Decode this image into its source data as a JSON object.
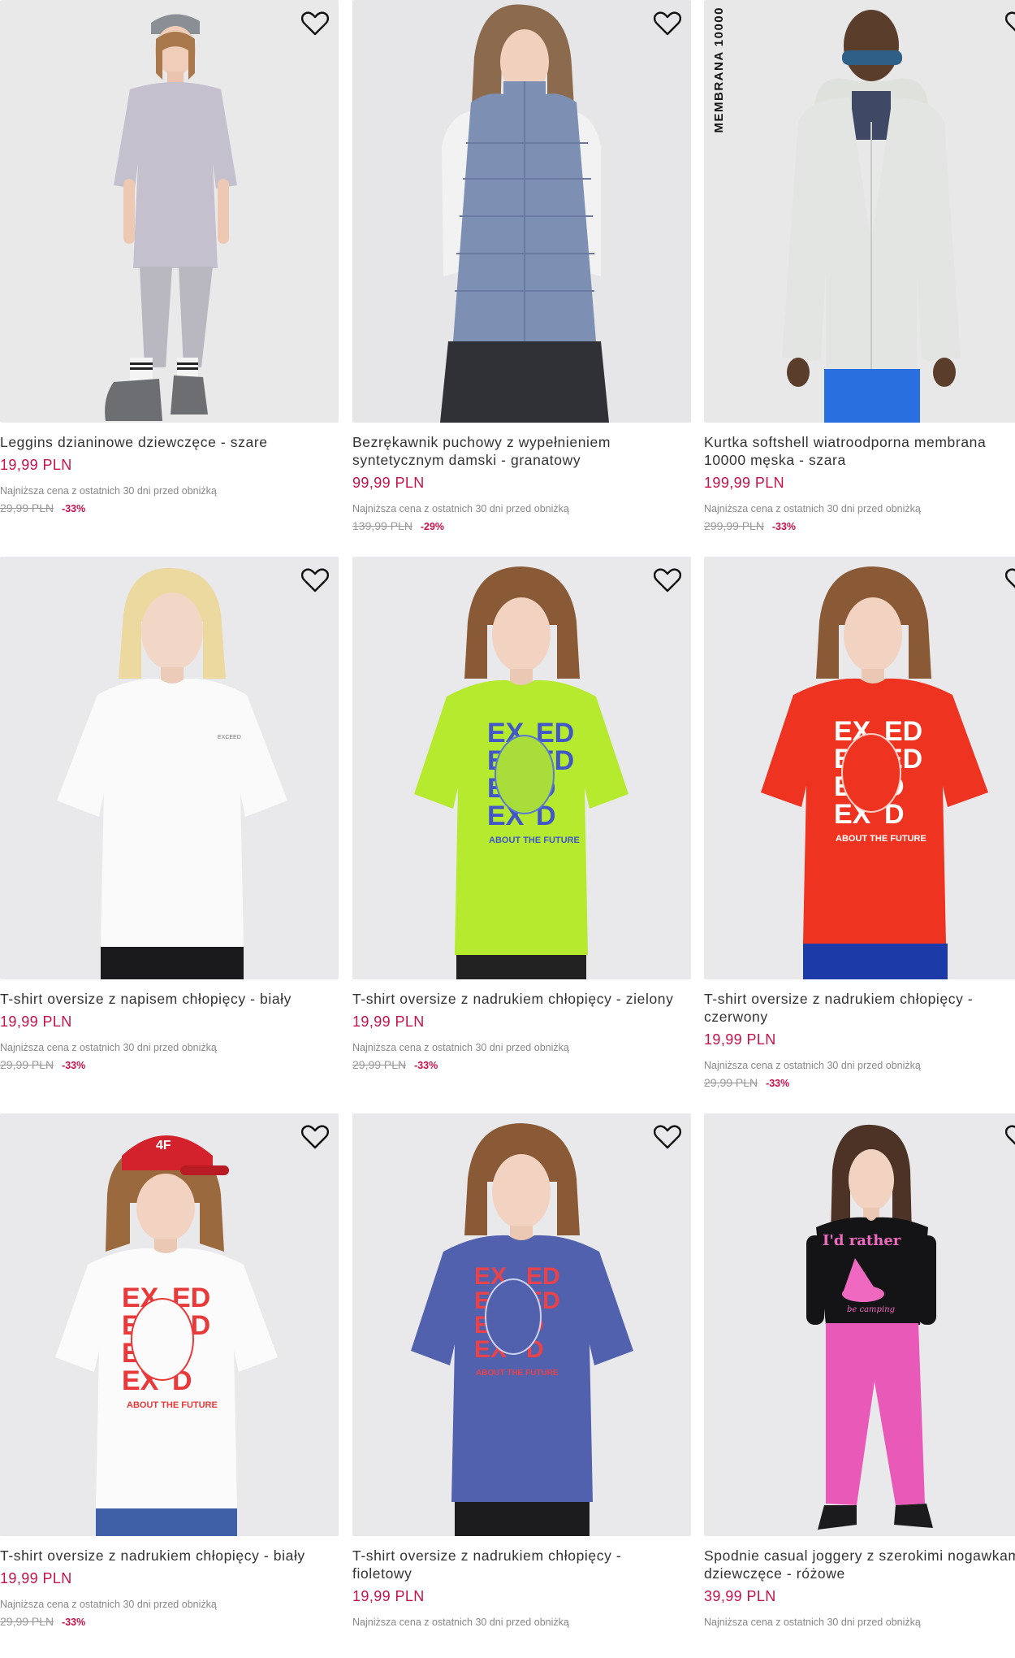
{
  "colors": {
    "price": "#c4124b",
    "muted": "#888888",
    "photo_bg": "#ececec"
  },
  "products": [
    {
      "name": "Leggins dzianinowe dziewczęce - szare",
      "price": "19,99 PLN",
      "lowest_label": "Najniższa cena z ostatnich 30 dni przed obniżką",
      "old_price": "29,99 PLN",
      "discount": "-33%",
      "badge": ""
    },
    {
      "name": "Bezrękawnik puchowy z wypełnieniem syntetycznym damski - granatowy",
      "price": "99,99 PLN",
      "lowest_label": "Najniższa cena z ostatnich 30 dni przed obniżką",
      "old_price": "139,99 PLN",
      "discount": "-29%",
      "badge": ""
    },
    {
      "name": "Kurtka softshell wiatroodporna membrana 10000 męska - szara",
      "price": "199,99 PLN",
      "lowest_label": "Najniższa cena z ostatnich 30 dni przed obniżką",
      "old_price": "299,99 PLN",
      "discount": "-33%",
      "badge": "MEMBRANA 10000"
    },
    {
      "name": "T-shirt oversize z napisem chłopięcy - biały",
      "price": "19,99 PLN",
      "lowest_label": "Najniższa cena z ostatnich 30 dni przed obniżką",
      "old_price": "29,99 PLN",
      "discount": "-33%",
      "badge": ""
    },
    {
      "name": "T-shirt oversize z nadrukiem chłopięcy - zielony",
      "price": "19,99 PLN",
      "lowest_label": "Najniższa cena z ostatnich 30 dni przed obniżką",
      "old_price": "29,99 PLN",
      "discount": "-33%",
      "badge": ""
    },
    {
      "name": "T-shirt oversize z nadrukiem chłopięcy - czerwony",
      "price": "19,99 PLN",
      "lowest_label": "Najniższa cena z ostatnich 30 dni przed obniżką",
      "old_price": "29,99 PLN",
      "discount": "-33%",
      "badge": ""
    },
    {
      "name": "T-shirt oversize z nadrukiem chłopięcy - biały",
      "price": "19,99 PLN",
      "lowest_label": "Najniższa cena z ostatnich 30 dni przed obniżką",
      "old_price": "29,99 PLN",
      "discount": "-33%",
      "badge": ""
    },
    {
      "name": "T-shirt oversize z nadrukiem chłopięcy - fioletowy",
      "price": "19,99 PLN",
      "lowest_label": "Najniższa cena z ostatnich 30 dni przed obniżką",
      "old_price": "",
      "discount": "",
      "badge": ""
    },
    {
      "name": "Spodnie casual joggery z szerokimi nogawkami dziewczęce - różowe",
      "price": "39,99 PLN",
      "lowest_label": "Najniższa cena z ostatnich 30 dni przed obniżką",
      "old_price": "",
      "discount": "",
      "badge": ""
    }
  ],
  "print_texts": {
    "exceed": "EXCEED",
    "tagline": "ABOUT THE FUTURE",
    "rather": "I'd rather",
    "camping": "be camping",
    "cap_logo": "4F"
  },
  "icons": {
    "wishlist": "heart-outline-icon"
  }
}
